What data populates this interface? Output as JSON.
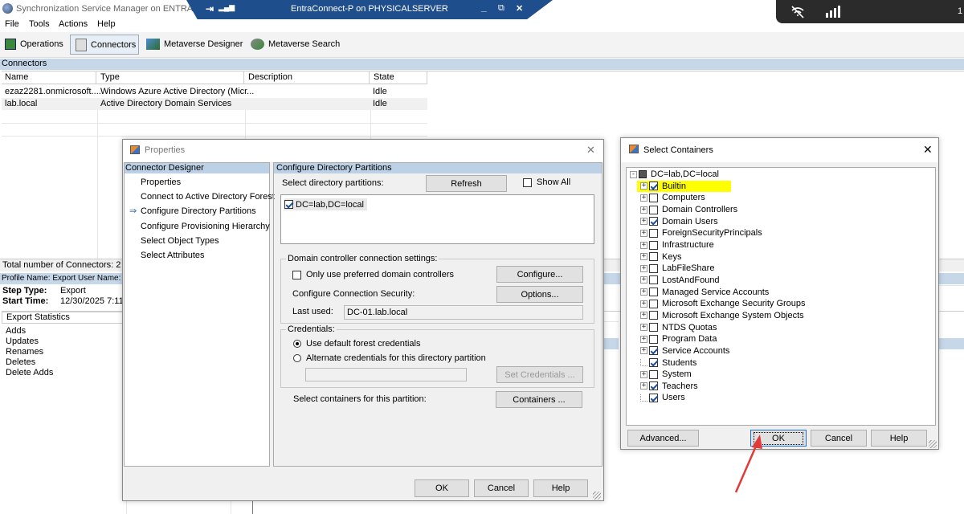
{
  "app": {
    "title": "Synchronization Service Manager on ENTRA",
    "menu": [
      "File",
      "Tools",
      "Actions",
      "Help"
    ],
    "toolbar": [
      "Operations",
      "Connectors",
      "Metaverse Designer",
      "Metaverse Search"
    ]
  },
  "rdp": {
    "title": "EntraConnect-P on PHYSICALSERVER",
    "pin": "⇥",
    "signal": "▂▄▆",
    "minimize": "_",
    "restore": "⧉",
    "close": "✕"
  },
  "taskbar": {
    "edge_text": "1"
  },
  "connectors": {
    "section_title": "Connectors",
    "columns": [
      "Name",
      "Type",
      "Description",
      "State"
    ],
    "rows": [
      {
        "name": "ezaz2281.onmicrosoft....",
        "type": "Windows Azure Active Directory (Micr...",
        "description": "",
        "state": "Idle"
      },
      {
        "name": "lab.local",
        "type": "Active Directory Domain Services",
        "description": "",
        "state": "Idle"
      }
    ],
    "total": "Total number of Connectors: 2"
  },
  "run": {
    "profile_line": "Profile Name: Export  User Name: N",
    "step_type_label": "Step Type:",
    "step_type": "Export",
    "start_time_label": "Start Time:",
    "start_time": "12/30/2025 7:11:",
    "stats_header": "Export Statistics",
    "stats": [
      "Adds",
      "Updates",
      "Renames",
      "Deletes",
      "Delete Adds"
    ]
  },
  "properties": {
    "title": "Properties",
    "close": "✕",
    "nav_header": "Connector Designer",
    "nav": [
      "Properties",
      "Connect to Active Directory Forest",
      "Configure Directory Partitions",
      "Configure Provisioning Hierarchy",
      "Select Object Types",
      "Select Attributes"
    ],
    "nav_arrow": "⇒",
    "panel_title": "Configure Directory Partitions",
    "select_label": "Select directory partitions:",
    "refresh": "Refresh",
    "show_all": "Show All",
    "partition": "DC=lab,DC=local",
    "dc_group": "Domain controller connection settings:",
    "only_preferred": "Only use preferred domain controllers",
    "configure": "Configure...",
    "conn_security": "Configure Connection Security:",
    "options": "Options...",
    "last_used_label": "Last used:",
    "last_used": "DC-01.lab.local",
    "cred_group": "Credentials:",
    "use_default": "Use default forest credentials",
    "alternate": "Alternate credentials for this directory partition",
    "set_credentials": "Set Credentials ...",
    "containers_label": "Select containers for this partition:",
    "containers": "Containers ...",
    "ok": "OK",
    "cancel": "Cancel",
    "help": "Help"
  },
  "containers_dialog": {
    "title": "Select Containers",
    "close": "✕",
    "root": "DC=lab,DC=local",
    "items": [
      {
        "label": "Builtin",
        "checked": true,
        "expand": true,
        "highlight": true
      },
      {
        "label": "Computers",
        "checked": false,
        "expand": true
      },
      {
        "label": "Domain Controllers",
        "checked": false,
        "expand": true
      },
      {
        "label": "Domain Users",
        "checked": true,
        "expand": true
      },
      {
        "label": "ForeignSecurityPrincipals",
        "checked": false,
        "expand": true
      },
      {
        "label": "Infrastructure",
        "checked": false,
        "expand": true
      },
      {
        "label": "Keys",
        "checked": false,
        "expand": true
      },
      {
        "label": "LabFileShare",
        "checked": false,
        "expand": true
      },
      {
        "label": "LostAndFound",
        "checked": false,
        "expand": true
      },
      {
        "label": "Managed Service Accounts",
        "checked": false,
        "expand": true
      },
      {
        "label": "Microsoft Exchange Security Groups",
        "checked": false,
        "expand": true
      },
      {
        "label": "Microsoft Exchange System Objects",
        "checked": false,
        "expand": true
      },
      {
        "label": "NTDS Quotas",
        "checked": false,
        "expand": true
      },
      {
        "label": "Program Data",
        "checked": false,
        "expand": true
      },
      {
        "label": "Service Accounts",
        "checked": true,
        "expand": true
      },
      {
        "label": "Students",
        "checked": true,
        "expand": false
      },
      {
        "label": "System",
        "checked": false,
        "expand": true
      },
      {
        "label": "Teachers",
        "checked": true,
        "expand": true
      },
      {
        "label": "Users",
        "checked": true,
        "expand": false
      }
    ],
    "advanced": "Advanced...",
    "ok": "OK",
    "cancel": "Cancel",
    "help": "Help"
  },
  "colors": {
    "rdp_bar": "#1e4e8c",
    "highlight": "#ffff00",
    "pane_header": "#bcd0e6",
    "arrow": "#e03a3a"
  }
}
